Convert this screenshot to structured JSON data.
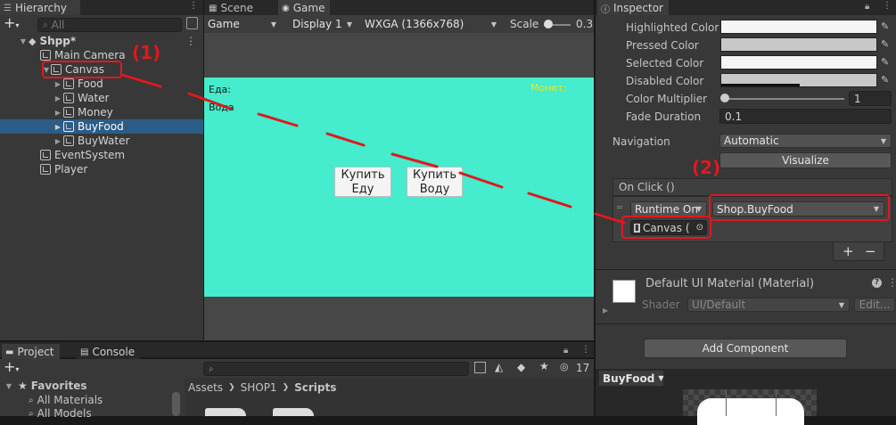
{
  "hierarchy": {
    "tab_label": "Hierarchy",
    "search_placeholder": "All",
    "scene_name": "Shpp*",
    "items": [
      {
        "label": "Main Camera",
        "indent": 1
      },
      {
        "label": "Canvas",
        "indent": 1
      },
      {
        "label": "Food",
        "indent": 2
      },
      {
        "label": "Water",
        "indent": 2
      },
      {
        "label": "Money",
        "indent": 2
      },
      {
        "label": "BuyFood",
        "indent": 2
      },
      {
        "label": "BuyWater",
        "indent": 2
      },
      {
        "label": "EventSystem",
        "indent": 1
      },
      {
        "label": "Player",
        "indent": 1
      }
    ]
  },
  "scene_tabs": {
    "scene_label": "Scene",
    "game_label": "Game"
  },
  "game_toolbar": {
    "view_select": "Game",
    "display_select": "Display 1",
    "resolution_select": "WXGA (1366x768)",
    "scale_label": "Scale",
    "scale_value": "0.3"
  },
  "game_view": {
    "food_text": "Еда:",
    "water_text": "Вода",
    "money_text": "Монет:",
    "buy_food_line1": "Купить",
    "buy_food_line2": "Еду",
    "buy_water_line1": "Купить",
    "buy_water_line2": "Воду",
    "background_color": "#45eccd",
    "money_color": "#e8e81c"
  },
  "inspector": {
    "tab_label": "Inspector",
    "highlighted_color_label": "Highlighted Color",
    "pressed_color_label": "Pressed Color",
    "selected_color_label": "Selected Color",
    "disabled_color_label": "Disabled Color",
    "color_multiplier_label": "Color Multiplier",
    "color_multiplier_value": "1",
    "fade_duration_label": "Fade Duration",
    "fade_duration_value": "0.1",
    "navigation_label": "Navigation",
    "navigation_value": "Automatic",
    "visualize_label": "Visualize",
    "on_click_label": "On Click ()",
    "runtime_value": "Runtime On",
    "function_value": "Shop.BuyFood",
    "target_object": "Canvas (",
    "add_label": "+",
    "remove_label": "−",
    "material_name": "Default UI Material (Material)",
    "shader_label": "Shader",
    "shader_value": "UI/Default",
    "shader_edit": "Edit...",
    "add_component_label": "Add Component",
    "preview_name": "BuyFood",
    "colors": {
      "highlighted": "#f5f5f5",
      "pressed": "#c8c8c8",
      "selected": "#f5f5f5",
      "disabled": "#c8c8c8"
    }
  },
  "project": {
    "project_tab": "Project",
    "console_tab": "Console",
    "favorites_label": "Favorites",
    "all_materials": "All Materials",
    "all_models": "All Models",
    "breadcrumb_assets": "Assets",
    "breadcrumb_shop": "SHOP1",
    "breadcrumb_scripts": "Scripts",
    "hidden_count": "17"
  },
  "annotations": {
    "label_1": "(1)",
    "label_2": "(2)",
    "color": "#e0181e"
  }
}
